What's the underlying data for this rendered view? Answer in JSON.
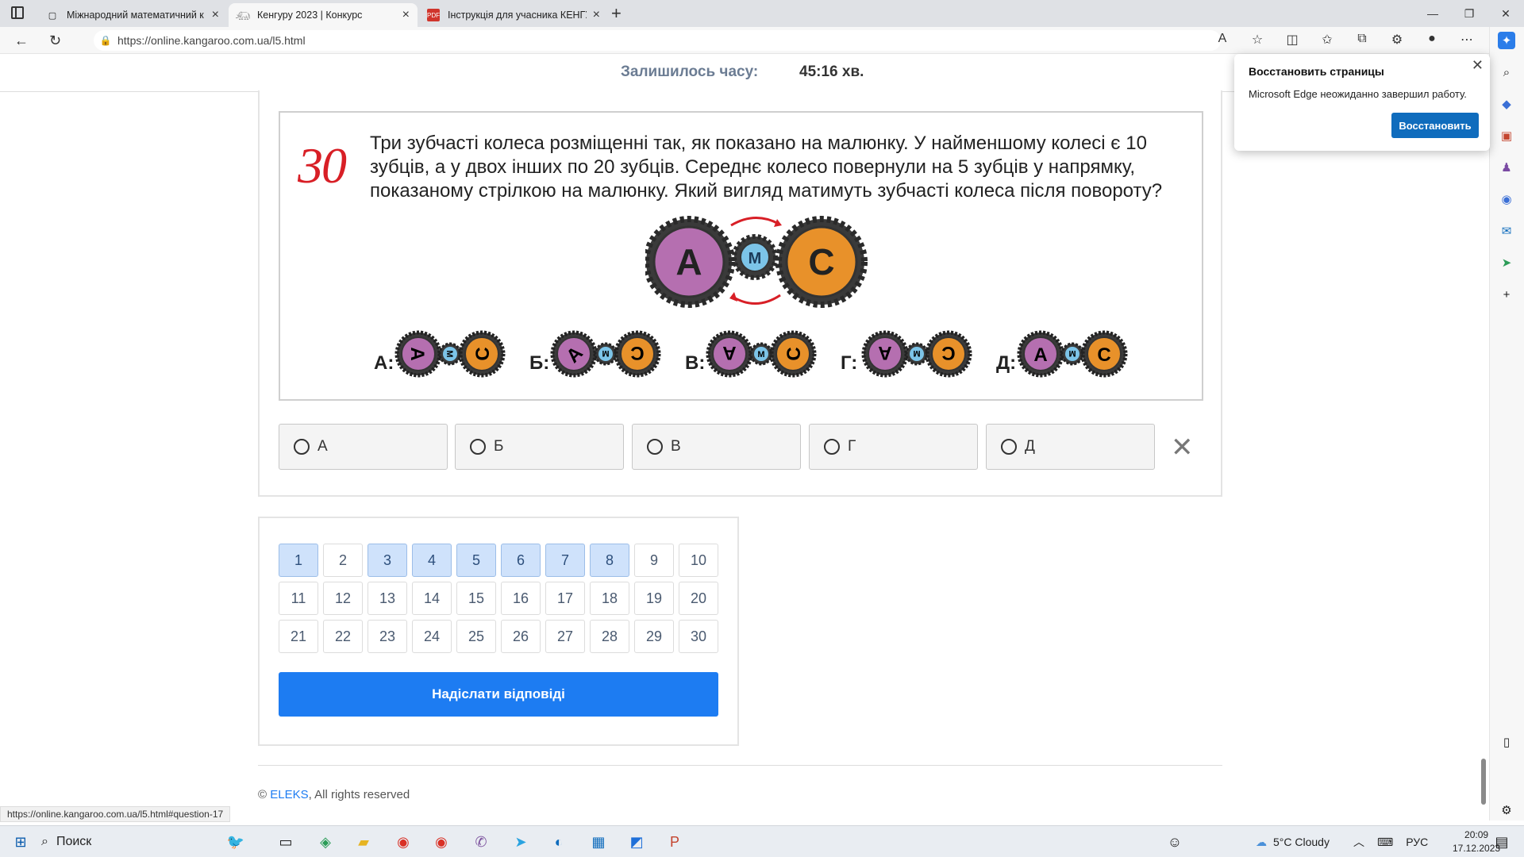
{
  "browser": {
    "tabs": [
      {
        "title": "Міжнародний математичний к",
        "active": false
      },
      {
        "title": "Кенгуру 2023 | Конкурс",
        "active": true
      },
      {
        "title": "Інструкція для учасника КЕНГУР",
        "active": false
      }
    ],
    "url": "https://online.kangaroo.com.ua/l5.html",
    "status_url": "https://online.kangaroo.com.ua/l5.html#question-17"
  },
  "timer": {
    "label": "Залишилось часу:",
    "value": "45:16 хв."
  },
  "question": {
    "number": "30",
    "text": "Три зубчасті колеса розміщенні так, як показано на малюнку. У найменшому колесі є 10 зубців, а у двох інших по 20 зубців. Середнє колесо повернули на 5 зубців у напрямку, показаному стрілкою на малюнку. Який вигляд матимуть зубчасті колеса після повороту?",
    "main_gears": {
      "left": "A",
      "middle": "M",
      "right": "C"
    },
    "image_options": [
      {
        "label": "А:",
        "letters": [
          "A",
          "M",
          "C"
        ]
      },
      {
        "label": "Б:",
        "letters": [
          "A",
          "M",
          "C"
        ]
      },
      {
        "label": "В:",
        "letters": [
          "A",
          "M",
          "C"
        ]
      },
      {
        "label": "Г:",
        "letters": [
          "A",
          "M",
          "C"
        ]
      },
      {
        "label": "Д:",
        "letters": [
          "A",
          "M",
          "C"
        ]
      }
    ]
  },
  "answers": [
    {
      "label": "А"
    },
    {
      "label": "Б"
    },
    {
      "label": "В"
    },
    {
      "label": "Г"
    },
    {
      "label": "Д"
    }
  ],
  "question_nav": {
    "numbers": [
      "1",
      "2",
      "3",
      "4",
      "5",
      "6",
      "7",
      "8",
      "9",
      "10",
      "11",
      "12",
      "13",
      "14",
      "15",
      "16",
      "17",
      "18",
      "19",
      "20",
      "21",
      "22",
      "23",
      "24",
      "25",
      "26",
      "27",
      "28",
      "29",
      "30"
    ],
    "answered": [
      1,
      3,
      4,
      5,
      6,
      7,
      8
    ]
  },
  "submit_label": "Надіслати відповіді",
  "footer": {
    "prefix": "© ",
    "brand": "ELEKS",
    "suffix": ", All rights reserved"
  },
  "popup": {
    "title": "Восстановить страницы",
    "message": "Microsoft Edge неожиданно завершил работу.",
    "button": "Восстановить"
  },
  "taskbar": {
    "search_placeholder": "Поиск",
    "weather": "5°C  Cloudy",
    "lang": "РУС",
    "time": "20:09",
    "date": "17.12.2023"
  },
  "colors": {
    "accent": "#1d7cf2",
    "answered": "#cfe2fb",
    "question_number": "#d81f26",
    "gear_purple": "#b56fb0",
    "gear_blue": "#7cc4e8",
    "gear_orange": "#e8912a"
  }
}
